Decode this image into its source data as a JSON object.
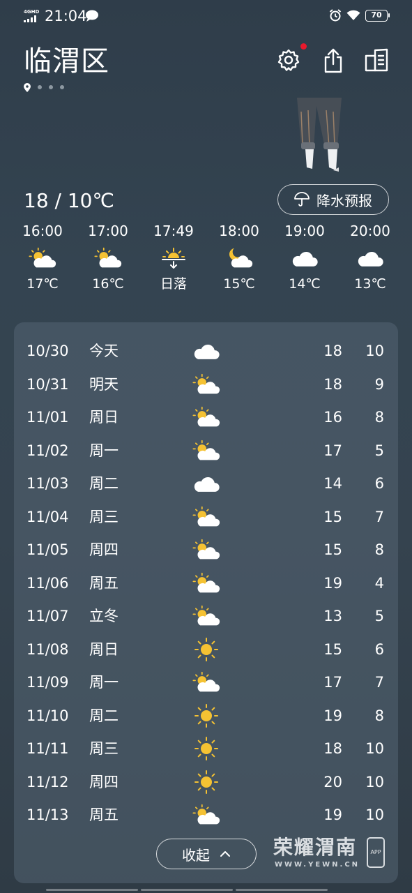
{
  "status_bar": {
    "network": "4GHD",
    "time": "21:04",
    "battery": "70",
    "icons": [
      "signal-icon",
      "chat-bubble-icon",
      "alarm-icon",
      "wifi-icon",
      "battery-icon"
    ]
  },
  "header": {
    "city": "临渭区",
    "icons": [
      "settings-icon",
      "share-icon",
      "city-list-icon",
      "location-icon"
    ]
  },
  "today": {
    "temp_range": "18 / 10℃",
    "precip_button": "降水预报"
  },
  "hourly": [
    {
      "time": "16:00",
      "icon": "partly-cloudy",
      "temp": "17℃"
    },
    {
      "time": "17:00",
      "icon": "partly-cloudy",
      "temp": "16℃"
    },
    {
      "time": "17:49",
      "icon": "sunset",
      "temp": "日落"
    },
    {
      "time": "18:00",
      "icon": "night-partly-cloudy",
      "temp": "15℃"
    },
    {
      "time": "19:00",
      "icon": "cloudy",
      "temp": "14℃"
    },
    {
      "time": "20:00",
      "icon": "cloudy",
      "temp": "13℃"
    }
  ],
  "daily": [
    {
      "date": "10/30",
      "name": "今天",
      "icon": "cloudy",
      "high": "18",
      "low": "10"
    },
    {
      "date": "10/31",
      "name": "明天",
      "icon": "partly-cloudy",
      "high": "18",
      "low": "9"
    },
    {
      "date": "11/01",
      "name": "周日",
      "icon": "partly-cloudy",
      "high": "16",
      "low": "8"
    },
    {
      "date": "11/02",
      "name": "周一",
      "icon": "partly-cloudy",
      "high": "17",
      "low": "5"
    },
    {
      "date": "11/03",
      "name": "周二",
      "icon": "cloudy",
      "high": "14",
      "low": "6"
    },
    {
      "date": "11/04",
      "name": "周三",
      "icon": "partly-cloudy",
      "high": "15",
      "low": "7"
    },
    {
      "date": "11/05",
      "name": "周四",
      "icon": "partly-cloudy",
      "high": "15",
      "low": "8"
    },
    {
      "date": "11/06",
      "name": "周五",
      "icon": "partly-cloudy",
      "high": "19",
      "low": "4"
    },
    {
      "date": "11/07",
      "name": "立冬",
      "icon": "partly-cloudy",
      "high": "13",
      "low": "5"
    },
    {
      "date": "11/08",
      "name": "周日",
      "icon": "sunny",
      "high": "15",
      "low": "6"
    },
    {
      "date": "11/09",
      "name": "周一",
      "icon": "partly-cloudy",
      "high": "17",
      "low": "7"
    },
    {
      "date": "11/10",
      "name": "周二",
      "icon": "sunny",
      "high": "19",
      "low": "8"
    },
    {
      "date": "11/11",
      "name": "周三",
      "icon": "sunny",
      "high": "18",
      "low": "10"
    },
    {
      "date": "11/12",
      "name": "周四",
      "icon": "sunny",
      "high": "20",
      "low": "10"
    },
    {
      "date": "11/13",
      "name": "周五",
      "icon": "partly-cloudy",
      "high": "19",
      "low": "10"
    }
  ],
  "collapse_button": "收起",
  "watermark": {
    "title": "荣耀渭南",
    "subtitle": "WWW.YEWN.CN",
    "badge": "APP"
  },
  "colors": {
    "sun": "#f5c233",
    "cloud": "#ffffff",
    "notification_dot": "#e8192c"
  }
}
